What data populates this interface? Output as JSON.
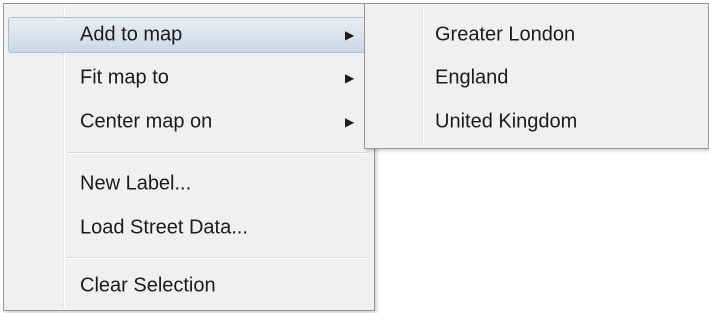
{
  "context_menu": {
    "items": [
      {
        "label": "Add to map",
        "has_submenu": true,
        "highlighted": true
      },
      {
        "label": "Fit map to",
        "has_submenu": true,
        "highlighted": false
      },
      {
        "label": "Center map on",
        "has_submenu": true,
        "highlighted": false
      },
      {
        "label": "New Label...",
        "has_submenu": false,
        "highlighted": false
      },
      {
        "label": "Load Street Data...",
        "has_submenu": false,
        "highlighted": false
      },
      {
        "label": "Clear Selection",
        "has_submenu": false,
        "highlighted": false
      }
    ],
    "submenu_arrow": "▶"
  },
  "submenu": {
    "items": [
      {
        "label": "Greater London"
      },
      {
        "label": "England"
      },
      {
        "label": "United Kingdom"
      }
    ]
  },
  "colors": {
    "menu_background": "#f0f0f0",
    "menu_border": "#979797",
    "highlight_top": "#e8eef6",
    "highlight_bottom": "#ccd8e7",
    "highlight_border": "#a8bfd8"
  },
  "icons": {
    "submenu_arrow": "triangle-right-icon"
  }
}
